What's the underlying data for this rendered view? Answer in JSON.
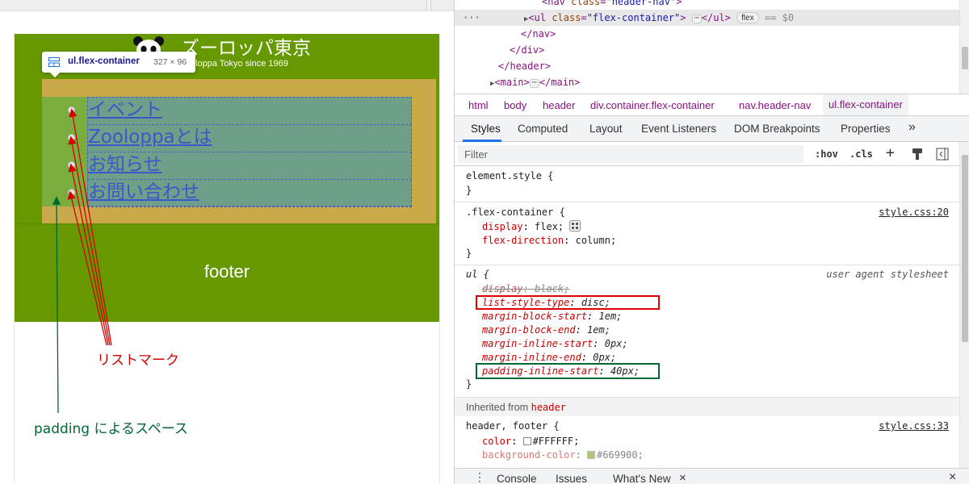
{
  "preview": {
    "site_title": "ズーロッパ東京",
    "site_subtitle": "oloppa Tokyo since 1969",
    "tooltip": {
      "name": "ul.flex-container",
      "size": "327 × 96"
    },
    "nav_items": [
      "イベント",
      "Zooloppaとは",
      "お知らせ",
      "お問い合わせ"
    ],
    "footer_text": "footer",
    "annotations": {
      "list_mark": "リストマーク",
      "padding_space": "padding によるスペース"
    },
    "colors": {
      "site_green": "#669900",
      "annotation_red": "#d40000",
      "annotation_green": "#006633"
    }
  },
  "dom_tree": {
    "lines": [
      {
        "tag_open": "<nav ",
        "attr": "class",
        "val": "\"header-nav\"",
        "tag_close": ">"
      },
      {
        "tag_open": "<ul ",
        "attr": "class",
        "val": "\"flex-container\"",
        "tag_close": ">",
        "ellipsis": "⋯",
        "end_tag": "</ul>",
        "badge": "flex",
        "eq": "== $0"
      },
      {
        "text": "</nav>"
      },
      {
        "text": "</div>"
      },
      {
        "text": "</header>"
      },
      {
        "tag_open": "<main>",
        "ellipsis": "⋯",
        "end_tag": "</main>"
      }
    ],
    "row_dots": "···"
  },
  "breadcrumbs": [
    "html",
    "body",
    "header",
    "div.container.flex-container",
    "nav.header-nav",
    "ul.flex-container"
  ],
  "panel_tabs": [
    "Styles",
    "Computed",
    "Layout",
    "Event Listeners",
    "DOM Breakpoints",
    "Properties",
    "»"
  ],
  "filter": {
    "placeholder": "Filter",
    "hov": ":hov",
    "cls": ".cls",
    "plus": "+"
  },
  "rules": {
    "element_style": {
      "selector": "element.style {",
      "close": "}"
    },
    "flex_container": {
      "selector": ".flex-container {",
      "source": "style.css:20",
      "props": [
        {
          "name": "display",
          "value": "flex;"
        },
        {
          "name": "flex-direction",
          "value": "column;"
        }
      ],
      "close": "}"
    },
    "ul": {
      "selector": "ul {",
      "source": "user agent stylesheet",
      "props": [
        {
          "name": "display",
          "value": "block;"
        },
        {
          "name": "list-style-type",
          "value": "disc;"
        },
        {
          "name": "margin-block-start",
          "value": "1em;"
        },
        {
          "name": "margin-block-end",
          "value": "1em;"
        },
        {
          "name": "margin-inline-start",
          "value": "0px;"
        },
        {
          "name": "margin-inline-end",
          "value": "0px;"
        },
        {
          "name": "padding-inline-start",
          "value": "40px;"
        }
      ],
      "close": "}"
    },
    "inherited": {
      "label": "Inherited from",
      "tag": "header"
    },
    "header_footer": {
      "selector": "header, footer {",
      "source": "style.css:33",
      "props": [
        {
          "name": "color",
          "value": "#FFFFFF;"
        },
        {
          "name": "background-color",
          "value": "#669900;"
        }
      ]
    }
  },
  "drawer_tabs": [
    "Console",
    "Issues",
    "What's New"
  ],
  "drawer_close": "×",
  "window_close": "×"
}
